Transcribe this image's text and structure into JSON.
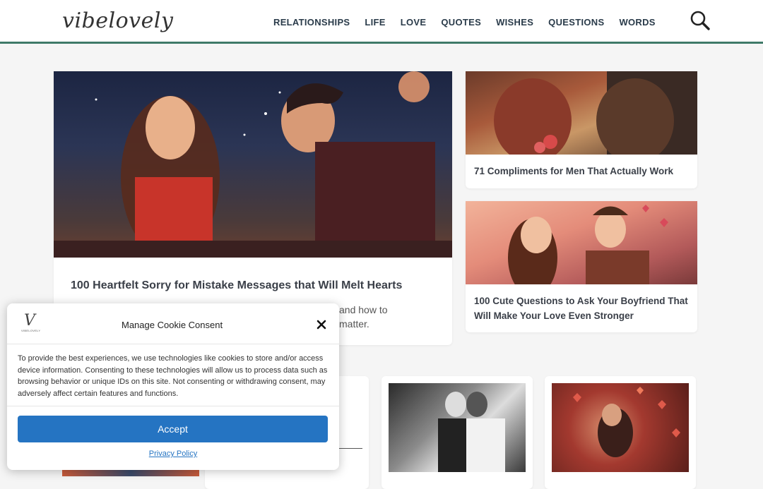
{
  "header": {
    "logo": "vibelovely",
    "nav": [
      "RELATIONSHIPS",
      "LIFE",
      "LOVE",
      "QUOTES",
      "WISHES",
      "QUESTIONS",
      "WORDS"
    ],
    "search_icon": "search-icon"
  },
  "featured": {
    "title": "100 Heartfelt Sorry for Mistake Messages that Will Melt Hearts",
    "excerpt_visible": "and how to\nmatter."
  },
  "side_posts": [
    {
      "title": "71 Compliments for Men That Actually Work"
    },
    {
      "title": "100 Cute Questions to Ask Your Boyfriend That Will Make Your Love Even Stronger"
    }
  ],
  "cookie": {
    "logo_monogram": "V",
    "logo_small": "VIBELOVELY",
    "title": "Manage Cookie Consent",
    "text": "To provide the best experiences, we use technologies like cookies to store and/or access device information. Consenting to these technologies will allow us to process data such as browsing behavior or unique IDs on this site. Not consenting or withdrawing consent, may adversely affect certain features and functions.",
    "accept_label": "Accept",
    "privacy_label": "Privacy Policy"
  },
  "colors": {
    "accent": "#3f7a68",
    "button": "#2574c2"
  }
}
